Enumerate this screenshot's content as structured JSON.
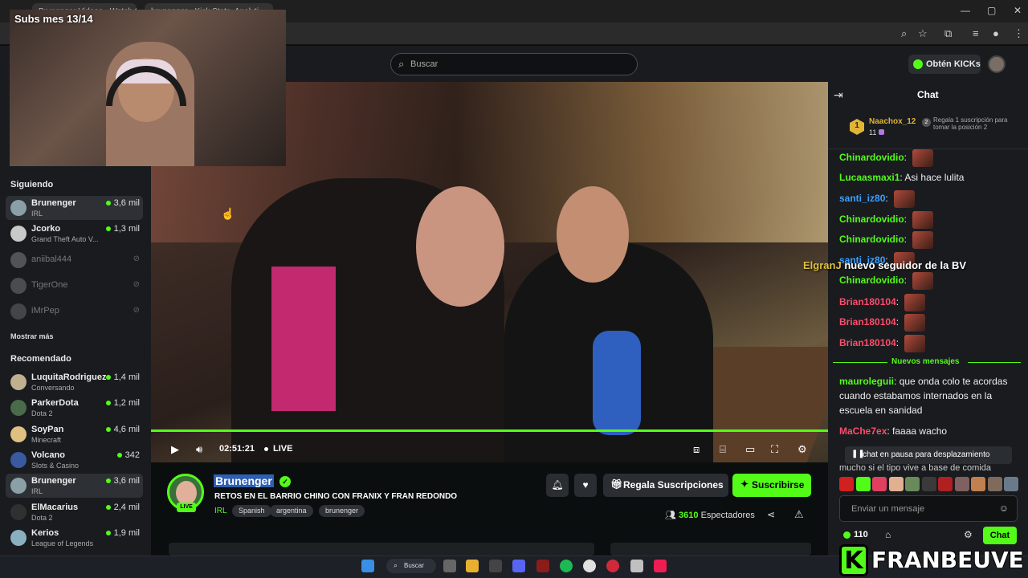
{
  "browser": {
    "tabs": [
      "Brunenger Videos - Watch On...",
      "brunenger - Kick Stats, Analyti..."
    ],
    "window_controls": [
      "—",
      "▢",
      "✕"
    ]
  },
  "header": {
    "search_placeholder": "Buscar",
    "kicks_label": "Obtén KICKs"
  },
  "webcam": {
    "subs_text": "Subs mes 13/14"
  },
  "sidebar": {
    "following_title": "Siguiendo",
    "following": [
      {
        "name": "Brunenger",
        "category": "IRL",
        "viewers": "3,6 mil",
        "active": true,
        "color": "#8aa0a6"
      },
      {
        "name": "Jcorko",
        "category": "Grand Theft Auto V...",
        "viewers": "1,3 mil",
        "color": "#c9c9c9"
      },
      {
        "name": "aniibal444",
        "offline": true,
        "color": "#9a9a9a"
      },
      {
        "name": "TigerOne",
        "offline": true,
        "color": "#8a8a8a"
      },
      {
        "name": "iMrPep",
        "offline": true,
        "color": "#7a7a7a"
      }
    ],
    "show_more": "Mostrar más",
    "recommended_title": "Recomendado",
    "recommended": [
      {
        "name": "LuquitaRodriguez",
        "category": "Conversando",
        "viewers": "1,4 mil",
        "color": "#c0b090"
      },
      {
        "name": "ParkerDota",
        "category": "Dota 2",
        "viewers": "1,2 mil",
        "color": "#4a6a4a"
      },
      {
        "name": "SoyPan",
        "category": "Minecraft",
        "viewers": "4,6 mil",
        "color": "#e0c080"
      },
      {
        "name": "Volcano",
        "category": "Slots & Casino",
        "viewers": "342",
        "color": "#3a5aa0"
      },
      {
        "name": "Brunenger",
        "category": "IRL",
        "viewers": "3,6 mil",
        "active": true,
        "color": "#8aa0a6"
      },
      {
        "name": "ElMacarius",
        "category": "Dota 2",
        "viewers": "2,4 mil",
        "color": "#303030"
      },
      {
        "name": "Kerios",
        "category": "League of Legends",
        "viewers": "1,9 mil",
        "color": "#8ab0c0"
      }
    ]
  },
  "player": {
    "time": "02:51:21",
    "live": "LIVE",
    "progress": 1.0
  },
  "stream": {
    "channel": "Brunenger",
    "title": "RETOS EN EL BARRIO CHINO CON FRANIX Y FRAN REDONDO",
    "category": "IRL",
    "tags": [
      "Spanish",
      "argentina",
      "brunenger"
    ],
    "live_badge": "LIVE",
    "gift_label": "Regala Suscripciones",
    "subscribe_label": "Suscribirse",
    "viewers_count": "3610",
    "viewers_label": "Espectadores"
  },
  "chat": {
    "title": "Chat",
    "top_gifter": {
      "rank": "1",
      "name": "Naachox_12",
      "count": "11"
    },
    "gift_prompt": "Regala 1 suscripción para tomar la posición 2",
    "gift_prompt_num": "2",
    "messages": [
      {
        "user": "Chinardovidio",
        "text": "",
        "color": "#53fc18",
        "emote": true
      },
      {
        "user": "Lucaasmaxi1",
        "text": "Asi hace lulita",
        "color": "#53fc18"
      },
      {
        "user": "santi_iz80",
        "text": "",
        "color": "#3aa0ff",
        "emote": true
      },
      {
        "user": "Chinardovidio",
        "text": "",
        "color": "#53fc18",
        "emote": true
      },
      {
        "user": "Chinardovidio",
        "text": "",
        "color": "#53fc18",
        "emote": true
      },
      {
        "user": "santi_iz80",
        "text": "",
        "color": "#3aa0ff",
        "emote": true
      },
      {
        "user": "Chinardovidio",
        "text": "",
        "color": "#53fc18",
        "emote": true
      },
      {
        "user": "Brian180104",
        "text": "",
        "color": "#ff4d6a",
        "emote": true
      },
      {
        "user": "Brian180104",
        "text": "",
        "color": "#ff4d6a",
        "emote": true
      },
      {
        "user": "Brian180104",
        "text": "",
        "color": "#ff4d6a",
        "emote": true
      }
    ],
    "new_messages": "Nuevos mensajes",
    "after_messages": [
      {
        "user": "mauroleguii",
        "lines": [
          "que onda colo te acordas",
          "cuando estabamos internados en la",
          "escuela en sanidad"
        ],
        "color": "#53fc18"
      },
      {
        "user": "MaChe7ex",
        "lines": [
          "faaaa wacho"
        ],
        "color": "#ff4d6a"
      }
    ],
    "follow_notice_name": "ElgranJ",
    "follow_notice_text": "nuevo seguidor de la BV",
    "partial_line": "mucho si el tipo vive a base de comida",
    "paused_text": "chat en pausa para desplazamiento",
    "input_placeholder": "Enviar un mensaje",
    "points": "110",
    "chat_button": "Chat"
  },
  "taskbar": {
    "search_label": "Buscar"
  },
  "watermark": {
    "letter": "K",
    "text": "FRANBEUVE"
  },
  "colors": {
    "accent": "#53fc18",
    "bg": "#0b0e0f",
    "panel": "#191b1f"
  }
}
